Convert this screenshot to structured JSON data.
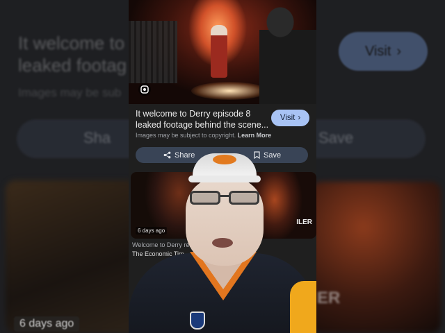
{
  "background_mirror": {
    "title": "It welcome to\nleaked footag",
    "subtitle": "Images may be sub",
    "visit_label": "Visit",
    "share_label": "Sha",
    "save_label": "Save",
    "days_ago": "6 days ago",
    "thumb_overlay": "ER"
  },
  "result": {
    "title": "It welcome to Derry episode 8\nleaked footage behind the scene...",
    "visit_label": "Visit",
    "copyright_text": "Images may be subject to copyright.",
    "learn_more": "Learn More",
    "share_label": "Share",
    "save_label": "Save"
  },
  "related": [
    {
      "badge": "6 days ago",
      "overlay": ""
    },
    {
      "badge": "",
      "overlay": "ILER"
    }
  ],
  "captions": {
    "line1": "Welcome to Derry re... e to Derry S01 E0...",
    "line2": "The Economic Tim..."
  },
  "colors": {
    "accent": "#a8c3f4",
    "panel": "#1f1f1f",
    "action_bar": "#394456",
    "jersey_orange": "#e2761f"
  },
  "icons": [
    "chevron-right-icon",
    "share-icon",
    "bookmark-icon",
    "lens-icon"
  ]
}
